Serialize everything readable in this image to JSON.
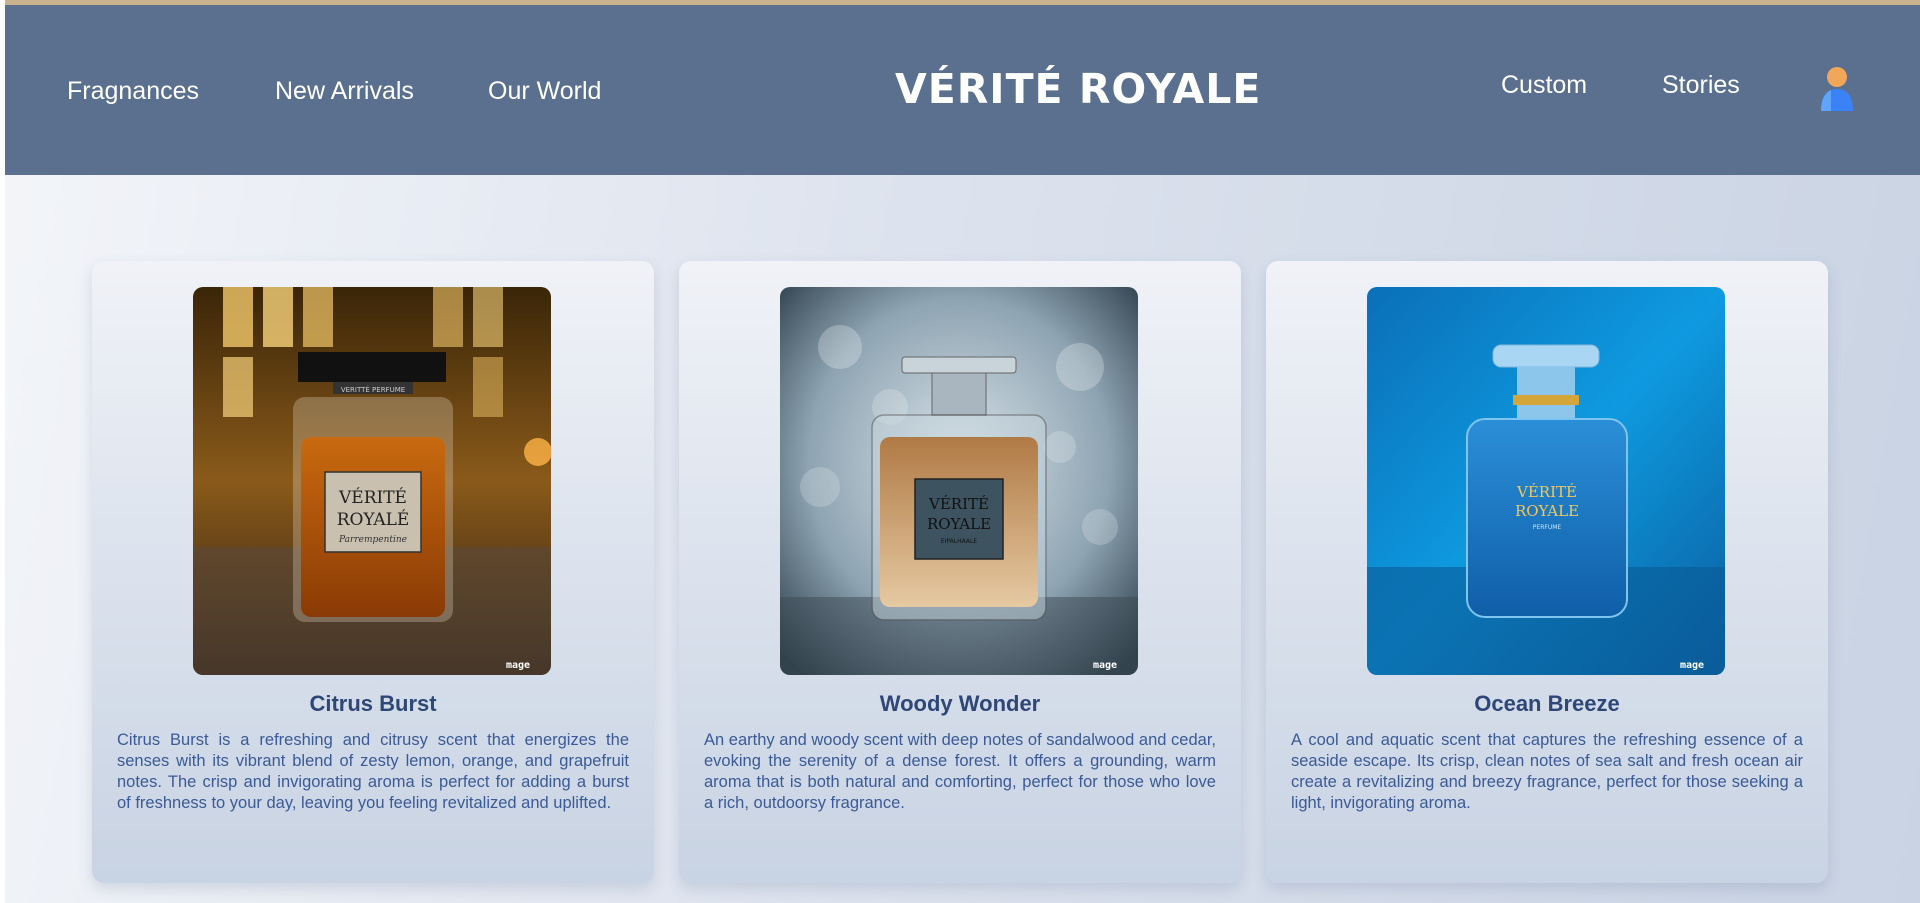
{
  "header": {
    "brand": "VÉRITÉ ROYALE",
    "nav_left": [
      "Fragnances",
      "New Arrivals",
      "Our World"
    ],
    "nav_right": [
      "Custom",
      "Stories"
    ],
    "user_icon": "user-icon"
  },
  "products": [
    {
      "title": "Citrus Burst",
      "description": "Citrus Burst is a refreshing and citrusy scent that energizes the senses with its vibrant blend of zesty lemon, orange, and grapefruit notes. The crisp and invigorating aroma is perfect for adding a burst of freshness to your day, leaving you feeling revitalized and uplifted.",
      "label_line1": "VÉRITÉ",
      "label_line2": "ROYALÉ",
      "label_line3": "Parrempentine",
      "cap_text": "VERITTÉ PERFUME",
      "watermark": "mage"
    },
    {
      "title": "Woody Wonder",
      "description": "An earthy and woody scent with deep notes of sandalwood and cedar, evoking the serenity of a dense forest. It offers a grounding, warm aroma that is both natural and comforting, perfect for those who love a rich, outdoorsy fragrance.",
      "label_line1": "VÉRITÉ",
      "label_line2": "ROYALE",
      "label_line3": "EIPALHAALE",
      "watermark": "mage"
    },
    {
      "title": "Ocean Breeze",
      "description": "A cool and aquatic scent that captures the refreshing essence of a seaside escape. Its crisp, clean notes of sea salt and fresh ocean air create a revitalizing and breezy fragrance, perfect for those seeking a light, invigorating aroma.",
      "label_line1": "VÉRITÉ",
      "label_line2": "ROYALE",
      "label_line3": "PERFUME",
      "watermark": "mage"
    }
  ],
  "colors": {
    "header_bg": "#5b6f8e",
    "accent_line": "#c9b38c",
    "title_color": "#2e4776",
    "text_color": "#3b5a96"
  }
}
